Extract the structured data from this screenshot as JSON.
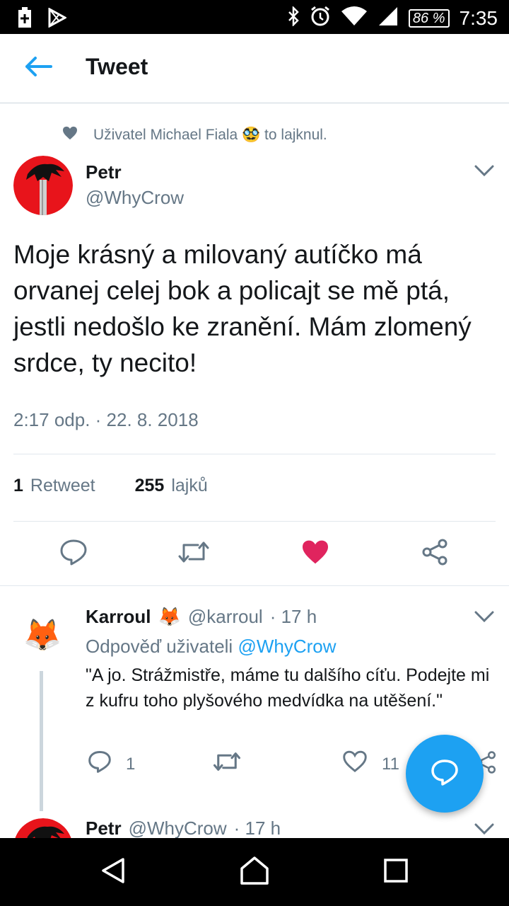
{
  "status_bar": {
    "battery": "86 %",
    "time": "7:35",
    "icons": [
      "plus-box-icon",
      "play-store-icon",
      "bluetooth-icon",
      "alarm-icon",
      "wifi-icon",
      "signal-icon"
    ]
  },
  "header": {
    "title": "Tweet",
    "back_icon": "arrow-left-icon"
  },
  "tweet": {
    "social_context": "Uživatel Michael Fiala 🥸 to lajknul.",
    "author_name": "Petr",
    "author_handle": "@WhyCrow",
    "text": "Moje krásný a milovaný autíčko má orvanej celej bok a policajt se mě ptá, jestli nedošlo ke zranění. Mám zlomený srdce, ty necito!",
    "timestamp": "2:17 odp. · 22. 8. 2018",
    "retweet_count": "1",
    "retweet_label": "Retweet",
    "like_count": "255",
    "like_label": "lajků",
    "liked": true,
    "colors": {
      "like": "#e0245e",
      "accent": "#1da1f2",
      "muted": "#657786"
    }
  },
  "reply": {
    "author_name": "Karroul",
    "author_emoji": "🦊",
    "author_handle": "@karroul",
    "time": "· 17 h",
    "reply_to_prefix": "Odpověď uživateli",
    "reply_to_handle": "@WhyCrow",
    "text": "\"A jo. Strážmistře, máme tu dalšího cíťu. Podejte mi z kufru toho plyšového medvídka na utěšení.\"",
    "reply_count": "1",
    "like_count": "11"
  },
  "next_tweet": {
    "author_name": "Petr",
    "author_handle": "@WhyCrow",
    "time": "· 17 h"
  },
  "fab": {
    "icon": "compose-reply-icon"
  },
  "nav_bar": {
    "icons": [
      "back-triangle-icon",
      "home-icon",
      "recents-icon"
    ]
  }
}
